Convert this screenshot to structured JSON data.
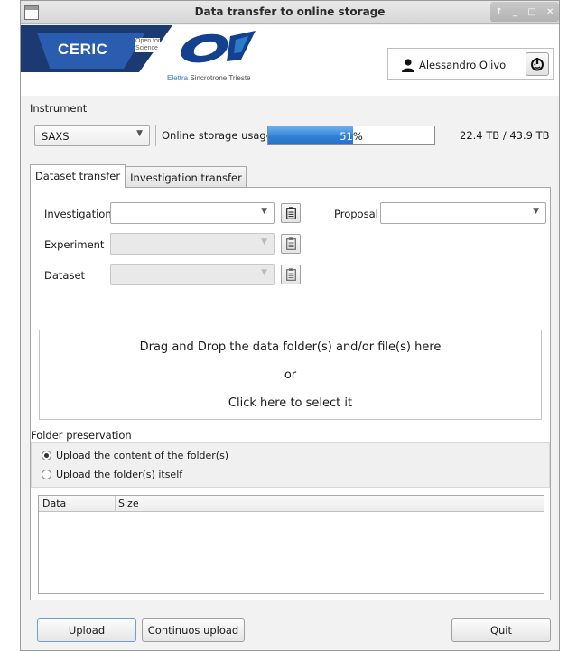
{
  "window": {
    "title": "Data transfer to online storage"
  },
  "logos": {
    "ceric": "CERIC",
    "ceric_sub_line1": "Open for",
    "ceric_sub_line2": "Science",
    "elettra_part1": "Elettra",
    "elettra_part2": " Sincrotrone Trieste"
  },
  "user": {
    "name": "Alessandro Olivo",
    "icon": "person-icon",
    "logout_icon": "logout-icon"
  },
  "instrument": {
    "label": "Instrument",
    "selected": "SAXS"
  },
  "storage": {
    "label": "Online storage usage",
    "percent": 51,
    "percent_text": "51%",
    "usage_text": "22.4 TB / 43.9 TB"
  },
  "tabs": [
    {
      "label": "Dataset transfer",
      "active": true
    },
    {
      "label": "Investigation transfer",
      "active": false
    }
  ],
  "form": {
    "investigation_label": "Investigation",
    "investigation_value": "",
    "proposal_label": "Proposal",
    "proposal_value": "",
    "experiment_label": "Experiment",
    "experiment_value": "",
    "dataset_label": "Dataset",
    "dataset_value": ""
  },
  "dropzone": {
    "line1": "Drag and Drop the data folder(s) and/or file(s) here",
    "line2": "or",
    "line3": "Click here to select it"
  },
  "folder_preservation": {
    "title": "Folder preservation",
    "options": [
      {
        "label": "Upload the content of the folder(s)",
        "selected": true
      },
      {
        "label": "Upload the folder(s) itself",
        "selected": false
      }
    ]
  },
  "table": {
    "columns": [
      "Data",
      "Size"
    ],
    "rows": []
  },
  "buttons": {
    "upload": "Upload",
    "continuous": "Continuos upload",
    "quit": "Quit"
  },
  "colors": {
    "accent": "#2d7fd3",
    "ceric_dark": "#1c3a72",
    "ceric_blue": "#2a5db0"
  }
}
